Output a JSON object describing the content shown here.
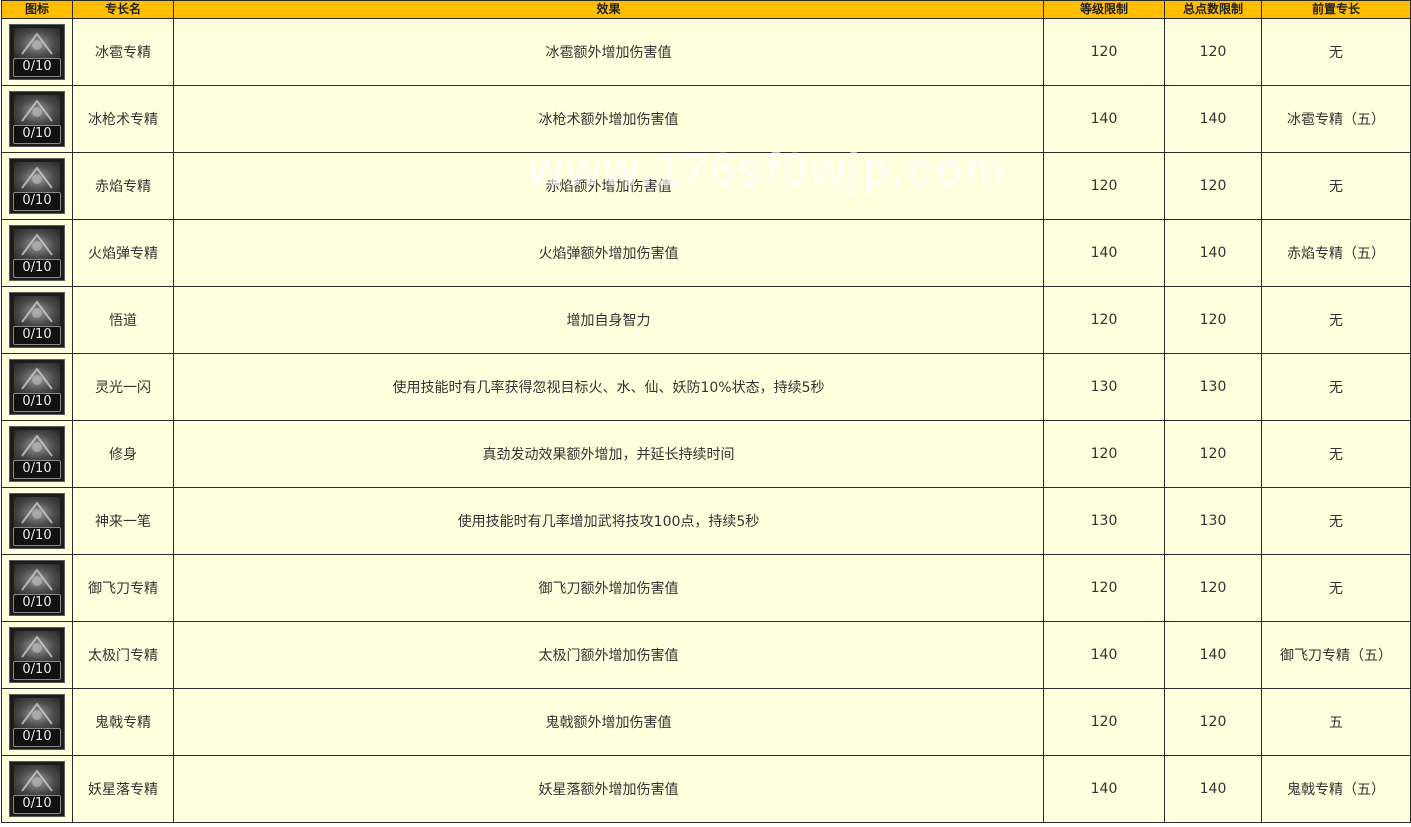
{
  "table": {
    "headers": {
      "icon": "图标",
      "name": "专长名",
      "effect": "效果",
      "level_limit": "等级限制",
      "total_points_limit": "总点数限制",
      "prerequisite": "前置专长"
    },
    "rows": [
      {
        "icon": "ice-hail-skill-icon",
        "level": "0/10",
        "name": "冰雹专精",
        "effect": "冰雹额外增加伤害值",
        "level_limit": "120",
        "total_points_limit": "120",
        "prerequisite": "无"
      },
      {
        "icon": "ice-spear-skill-icon",
        "level": "0/10",
        "name": "冰枪术专精",
        "effect": "冰枪术额外增加伤害值",
        "level_limit": "140",
        "total_points_limit": "140",
        "prerequisite": "冰雹专精（五）"
      },
      {
        "icon": "red-flame-skill-icon",
        "level": "0/10",
        "name": "赤焰专精",
        "effect": "赤焰额外增加伤害值",
        "level_limit": "120",
        "total_points_limit": "120",
        "prerequisite": "无"
      },
      {
        "icon": "fireball-skill-icon",
        "level": "0/10",
        "name": "火焰弹专精",
        "effect": "火焰弹额外增加伤害值",
        "level_limit": "140",
        "total_points_limit": "140",
        "prerequisite": "赤焰专精（五）"
      },
      {
        "icon": "enlightenment-skill-icon",
        "level": "0/10",
        "name": "悟道",
        "effect": "增加自身智力",
        "level_limit": "120",
        "total_points_limit": "120",
        "prerequisite": "无"
      },
      {
        "icon": "inspiration-skill-icon",
        "level": "0/10",
        "name": "灵光一闪",
        "effect": "使用技能时有几率获得忽视目标火、水、仙、妖防10%状态，持续5秒",
        "level_limit": "130",
        "total_points_limit": "130",
        "prerequisite": "无"
      },
      {
        "icon": "self-cultivation-skill-icon",
        "level": "0/10",
        "name": "修身",
        "effect": "真劲发动效果额外增加，并延长持续时间",
        "level_limit": "120",
        "total_points_limit": "120",
        "prerequisite": "无"
      },
      {
        "icon": "divine-stroke-skill-icon",
        "level": "0/10",
        "name": "神来一笔",
        "effect": "使用技能时有几率增加武将技攻100点，持续5秒",
        "level_limit": "130",
        "total_points_limit": "130",
        "prerequisite": "无"
      },
      {
        "icon": "flying-blade-skill-icon",
        "level": "0/10",
        "name": "御飞刀专精",
        "effect": "御飞刀额外增加伤害值",
        "level_limit": "120",
        "total_points_limit": "120",
        "prerequisite": "无"
      },
      {
        "icon": "taiji-gate-skill-icon",
        "level": "0/10",
        "name": "太极门专精",
        "effect": "太极门额外增加伤害值",
        "level_limit": "140",
        "total_points_limit": "140",
        "prerequisite": "御飞刀专精（五）"
      },
      {
        "icon": "ghost-halberd-skill-icon",
        "level": "0/10",
        "name": "鬼戟专精",
        "effect": "鬼戟额外增加伤害值",
        "level_limit": "120",
        "total_points_limit": "120",
        "prerequisite": "五"
      },
      {
        "icon": "demon-star-fall-skill-icon",
        "level": "0/10",
        "name": "妖星落专精",
        "effect": "妖星落额外增加伤害值",
        "level_limit": "140",
        "total_points_limit": "140",
        "prerequisite": "鬼戟专精（五）"
      }
    ]
  },
  "watermark": "www.176sf0wjp.com",
  "colors": {
    "header_bg": "#ffbf00",
    "row_bg": "#ffffdd",
    "border": "#2a2a2a"
  }
}
